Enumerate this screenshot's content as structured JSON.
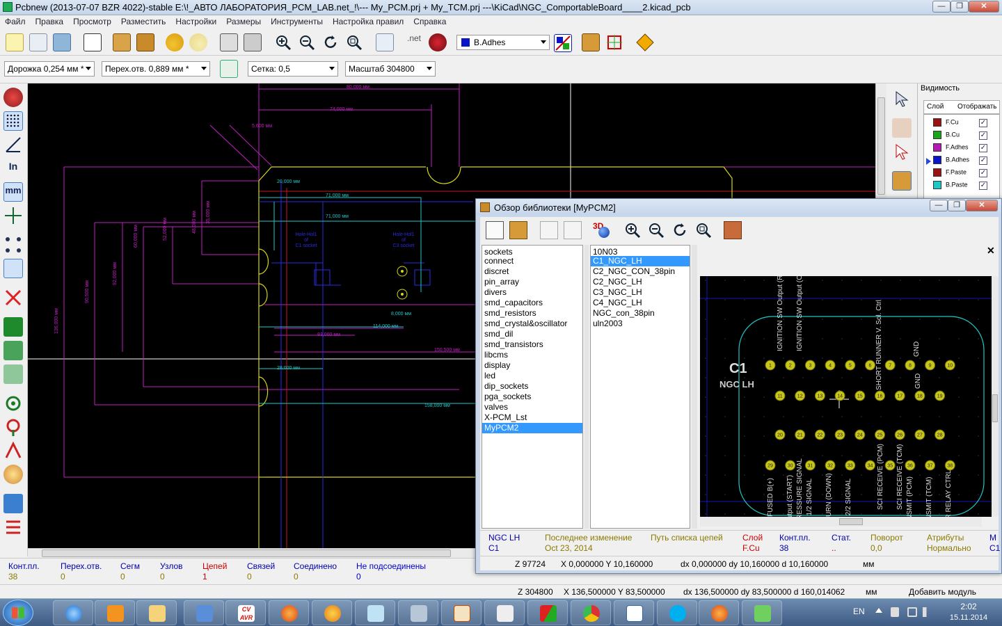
{
  "window": {
    "title": "Pcbnew (2013-07-07 BZR 4022)-stable E:\\!_АВТО ЛАБОРАТОРИЯ_PCM_LAB.net_!\\--- My_PCM.prj + My_TCM.prj ---\\KiCad\\NGC_ComportableBoard____2.kicad_pcb",
    "min": "—",
    "max": "❐",
    "close": "✕"
  },
  "menu": [
    "Файл",
    "Правка",
    "Просмотр",
    "Разместить",
    "Настройки",
    "Размеры",
    "Инструменты",
    "Настройка правил",
    "Справка"
  ],
  "toolbar": {
    "layer_select": "B.Adhes",
    "layer_color": "#0b14c8"
  },
  "toolbar2": {
    "track": "Дорожка 0,254 мм *",
    "via": "Перех.отв. 0,889 мм *",
    "grid": "Сетка: 0,5",
    "zoom": "Масштаб 304800"
  },
  "left_tools": {
    "in": "In",
    "mm": "mm"
  },
  "visibility": {
    "title": "Видимость",
    "tab_layers": "Слой",
    "tab_render": "Отображать",
    "layers": [
      {
        "name": "F.Cu",
        "color": "#9b1212",
        "checked": "✓"
      },
      {
        "name": "B.Cu",
        "color": "#1aa61a",
        "checked": "✓"
      },
      {
        "name": "F.Adhes",
        "color": "#b21ab2",
        "checked": "✓"
      },
      {
        "name": "B.Adhes",
        "color": "#0b14c8",
        "checked": "✓",
        "active": true
      },
      {
        "name": "F.Paste",
        "color": "#9b1212",
        "checked": "✓"
      },
      {
        "name": "B.Paste",
        "color": "#1ac8c8",
        "checked": "✓"
      }
    ]
  },
  "pcb": {
    "dims": [
      "80,000 мм",
      "74,000 мм",
      "5,600 мм",
      "20,000 мм",
      "71,000 мм",
      "71,000 мм",
      "114,000 мм",
      "83,000 мм",
      "150,500 мм",
      "28,000 мм",
      "158,000 мм",
      "8,000 мм"
    ],
    "vdims": [
      "136,000 мм",
      "90,500 мм",
      "92,000 мм",
      "60,000 мм",
      "52,000 мм",
      "48,000 мм",
      "35,000 мм"
    ],
    "holes": [
      "Hole-Hol1 of C1 socket",
      "Hole-Hol1 of C3 socket"
    ],
    "hole_words": [
      "Hole-Hol1",
      "of",
      "C1 socket",
      "C3 socket"
    ]
  },
  "status": {
    "labels": [
      "Конт.пл.",
      "Перех.отв.",
      "Сегм",
      "Узлов",
      "Цепей",
      "Связей",
      "Соединено",
      "Не подсоединены"
    ],
    "values": [
      "38",
      "0",
      "0",
      "0",
      "1",
      "0",
      "0",
      "0"
    ]
  },
  "status2": {
    "z": "Z 304800",
    "xy": "X 136,500000  Y 83,500000",
    "dxy": "dx 136,500000  dy 83,500000  d 160,014062",
    "unit": "мм",
    "mode": "Добавить модуль"
  },
  "dialog": {
    "title": "Обзор библиотеки [MyPCM2]",
    "libs": [
      "sockets",
      "connect",
      "discret",
      "pin_array",
      "divers",
      "smd_capacitors",
      "smd_resistors",
      "smd_crystal&oscillator",
      "smd_dil",
      "smd_transistors",
      "libcms",
      "display",
      "led",
      "dip_sockets",
      "pga_sockets",
      "valves",
      "X-PCM_Lst",
      "MyPCM2"
    ],
    "selected_lib": "MyPCM2",
    "modules": [
      "10N03",
      "C1_NGC_LH",
      "C2_NGC_CON_38pin",
      "C2_NGC_LH",
      "C3_NGC_LH",
      "C4_NGC_LH",
      "NGC_con_38pin",
      "uln2003"
    ],
    "selected_module": "C1_NGC_LH",
    "preview": {
      "ref": "C1",
      "value": "NGC LH",
      "pads_row1": [
        "1",
        "2",
        "3",
        "4",
        "5",
        "6",
        "7",
        "8",
        "9",
        "10"
      ],
      "pads_row2": [
        "11",
        "12",
        "13",
        "14",
        "15",
        "16",
        "17",
        "18",
        "19"
      ],
      "pads_row3": [
        "20",
        "21",
        "22",
        "23",
        "24",
        "25",
        "26",
        "27",
        "28"
      ],
      "pads_row4": [
        "29",
        "30",
        "31",
        "32",
        "33",
        "34",
        "35",
        "36",
        "37",
        "38"
      ],
      "top_labels": [
        "IGNITION SW Output (RUN-START",
        "IGNITION SW Output (OFF-RUN-",
        "SHORT RUNNER V. Sol. Ctrl",
        "GND",
        "GND"
      ],
      "bottom_labels": [
        "FUSED B(+)",
        "SW Output (START)",
        "A/C PRESSURE SIGNAL",
        "NSOR 1/2 SIGNAL",
        "R RETURN (DOWN)",
        "NSOR 2/2 SIGNAL",
        "SCI RECEIVE (PCM)",
        "SCI RECEIVE (TCM)",
        "I TRANSMIT (PCM)",
        "I TRANSMIT (TCM)",
        "ARTER RELAY CTRL"
      ]
    },
    "info": {
      "headers": [
        "NGC LH",
        "Последнее изменение",
        "Путь списка цепей",
        "Слой",
        "Конт.пл.",
        "Стат.",
        "Поворот",
        "Атрибуты",
        "М"
      ],
      "values": [
        "C1",
        "Oct 23, 2014",
        "",
        "F.Cu",
        "38",
        "..",
        "0,0",
        "Нормально",
        "C1"
      ]
    },
    "status": {
      "z": "Z 97724",
      "xy": "X 0,000000  Y 10,160000",
      "dxy": "dx 0,000000  dy 10,160000  d 10,160000",
      "unit": "мм"
    }
  },
  "tray": {
    "lang": "EN",
    "time": "2:02",
    "date": "15.11.2014"
  },
  "taskbar_apps": [
    "ie-icon",
    "media-icon",
    "folder-icon",
    "tools-icon",
    "cvavr-icon",
    "firefox-icon",
    "paint-icon",
    "notepad-icon",
    "wrench-icon",
    "kicad-icon",
    "files-icon",
    "pdf-icon",
    "chrome-icon",
    "ink-icon",
    "skype-icon",
    "firefox2-icon",
    "green-icon"
  ],
  "labels": {
    "net": ".net",
    "3d": "3D",
    "cvavr": "CV AVR"
  }
}
